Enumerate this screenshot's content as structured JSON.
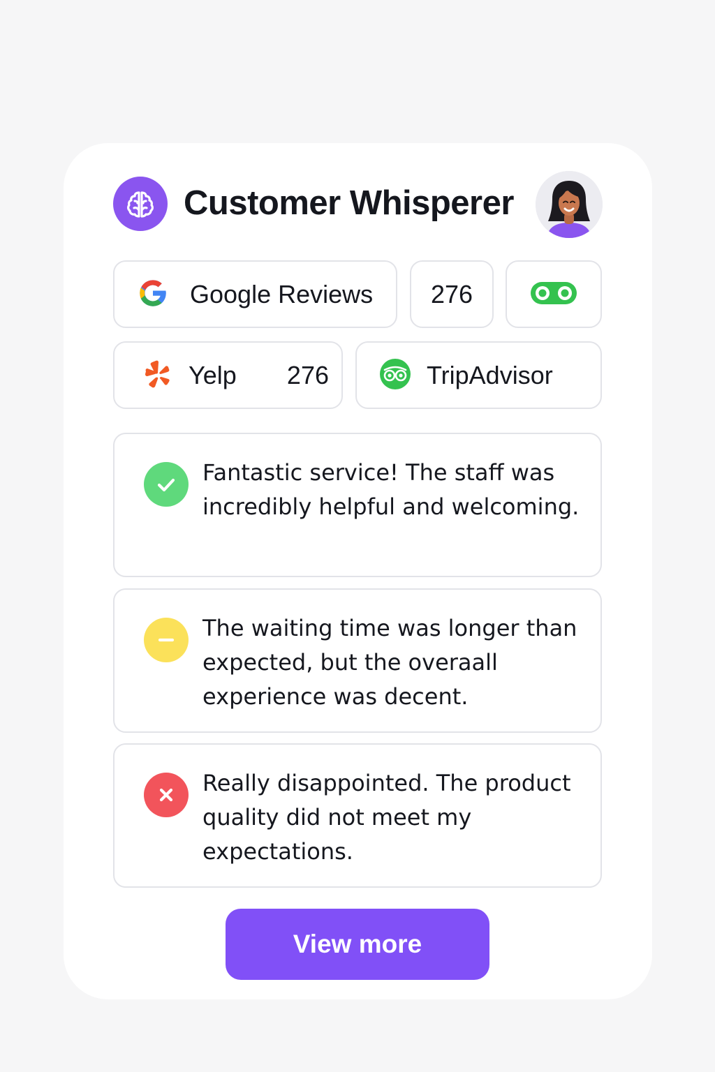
{
  "header": {
    "app_title": "Customer Whisperer",
    "logo_icon": "brain-icon",
    "avatar_icon": "user-avatar"
  },
  "platforms": {
    "google": {
      "label": "Google Reviews",
      "icon": "google-icon"
    },
    "count_chip": {
      "value": "276"
    },
    "tripadvisor_owl": {
      "icon": "tripadvisor-owl-icon"
    },
    "yelp": {
      "label": "Yelp",
      "count": "276",
      "icon": "yelp-icon"
    },
    "tripadvisor": {
      "label": "TripAdvisor",
      "icon": "tripadvisor-icon"
    }
  },
  "reviews": [
    {
      "sentiment": "positive",
      "icon": "check-icon",
      "text": "Fantastic service! The staff was incredibly helpful and welcoming."
    },
    {
      "sentiment": "neutral",
      "icon": "minus-icon",
      "text": "The waiting time was longer than expected, but the overaall experience was decent."
    },
    {
      "sentiment": "negative",
      "icon": "x-icon",
      "text": "Really disappointed. The product quality did not meet my expectations."
    }
  ],
  "actions": {
    "view_more_label": "View more"
  },
  "colors": {
    "accent": "#8150f7",
    "positive": "#5fd97c",
    "neutral": "#fbe15a",
    "negative": "#f2545b",
    "tripadvisor": "#34c24f",
    "yelp": "#f15a24"
  }
}
